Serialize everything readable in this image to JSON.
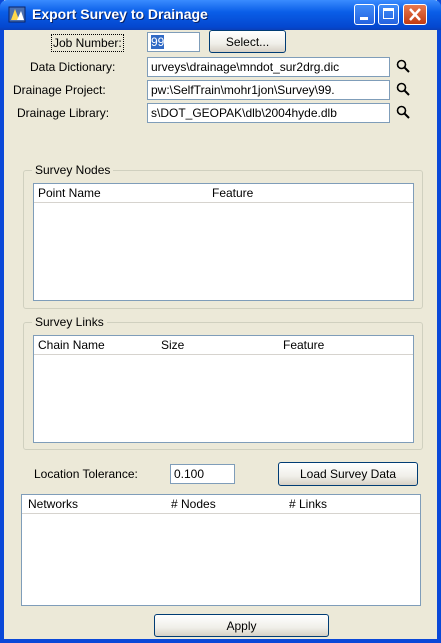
{
  "window": {
    "title": "Export Survey to Drainage"
  },
  "form": {
    "job_number_label": "Job Number:",
    "job_number_value": "99",
    "select_button": "Select...",
    "data_dictionary_label": "Data Dictionary:",
    "data_dictionary_value": "urveys\\drainage\\mndot_sur2drg.dic",
    "drainage_project_label": "Drainage Project:",
    "drainage_project_value": "pw:\\SelfTrain\\mohr1jon\\Survey\\99.",
    "drainage_library_label": "Drainage Library:",
    "drainage_library_value": "s\\DOT_GEOPAK\\dlb\\2004hyde.dlb"
  },
  "survey_nodes": {
    "title": "Survey Nodes",
    "columns": [
      "Point Name",
      "Feature"
    ]
  },
  "survey_links": {
    "title": "Survey Links",
    "columns": [
      "Chain Name",
      "Size",
      "Feature"
    ]
  },
  "tolerance": {
    "label": "Location Tolerance:",
    "value": "0.100",
    "load_button": "Load Survey Data"
  },
  "networks": {
    "columns": [
      "Networks",
      "# Nodes",
      "# Links"
    ]
  },
  "footer": {
    "apply_button": "Apply"
  },
  "icons": {
    "app": "app-icon",
    "browse": "magnifier-icon"
  },
  "colors": {
    "titlebar": "#0a5ee8",
    "dialog_bg": "#ece9d8",
    "close_button": "#c23b12"
  }
}
